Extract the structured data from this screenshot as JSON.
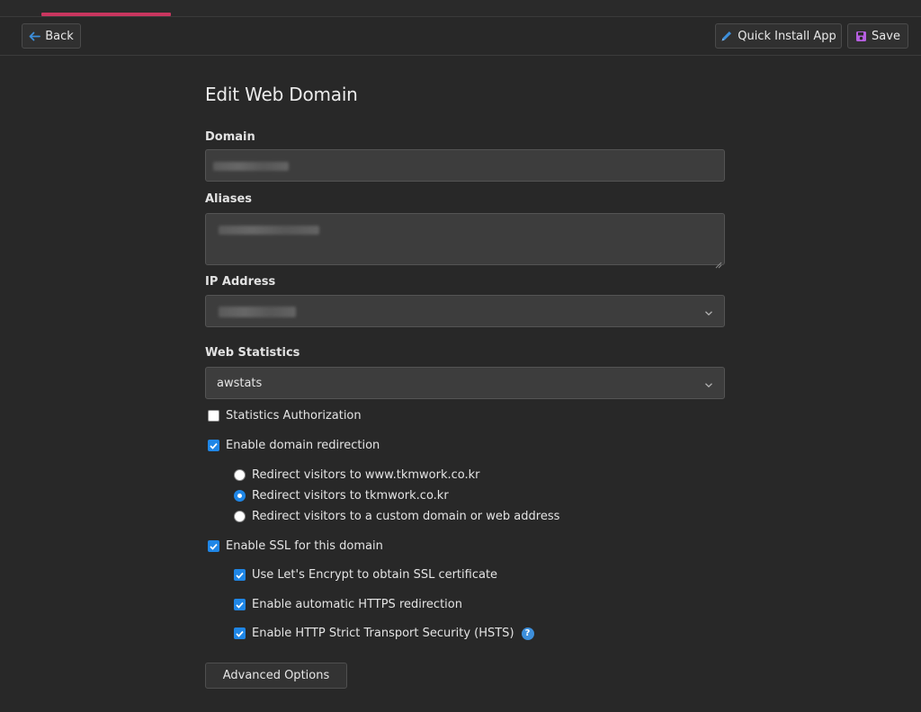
{
  "toolbar": {
    "back_label": "Back",
    "quick_install_label": "Quick Install App",
    "save_label": "Save"
  },
  "form": {
    "title": "Edit Web Domain",
    "domain": {
      "label": "Domain"
    },
    "aliases": {
      "label": "Aliases"
    },
    "ip_address": {
      "label": "IP Address"
    },
    "web_statistics": {
      "label": "Web Statistics",
      "value": "awstats"
    },
    "statistics_authorization": {
      "label": "Statistics Authorization",
      "checked": false
    },
    "domain_redirection": {
      "label": "Enable domain redirection",
      "checked": true,
      "options": [
        {
          "label": "Redirect visitors to www.tkmwork.co.kr",
          "selected": false
        },
        {
          "label": "Redirect visitors to tkmwork.co.kr",
          "selected": true
        },
        {
          "label": "Redirect visitors to a custom domain or web address",
          "selected": false
        }
      ]
    },
    "ssl": {
      "label": "Enable SSL for this domain",
      "checked": true,
      "options": [
        {
          "label": "Use Let's Encrypt to obtain SSL certificate",
          "checked": true
        },
        {
          "label": "Enable automatic HTTPS redirection",
          "checked": true
        },
        {
          "label": "Enable HTTP Strict Transport Security (HSTS)",
          "checked": true,
          "help_icon": "question-icon"
        }
      ]
    },
    "advanced_label": "Advanced Options"
  },
  "colors": {
    "background": "#282828",
    "accent": "#c9365f",
    "checkbox": "#1f86e6",
    "save_icon": "#b65fe0",
    "back_icon": "#3d8fdb"
  }
}
